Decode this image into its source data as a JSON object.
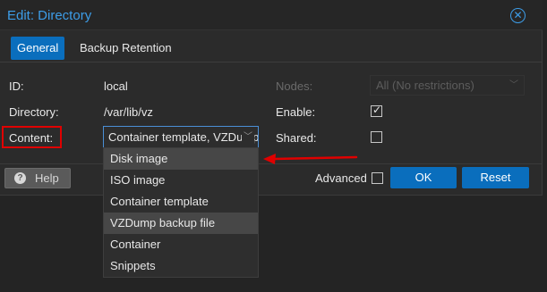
{
  "dialog": {
    "title": "Edit: Directory",
    "close_icon": "close-circle-icon"
  },
  "tabs": [
    {
      "label": "General",
      "active": true
    },
    {
      "label": "Backup Retention",
      "active": false
    }
  ],
  "form": {
    "id_label": "ID:",
    "id_value": "local",
    "directory_label": "Directory:",
    "directory_value": "/var/lib/vz",
    "content_label": "Content:",
    "content_value": "Container template, VZDump backup file",
    "nodes_label": "Nodes:",
    "nodes_value": "All (No restrictions)",
    "enable_label": "Enable:",
    "enable_checked": true,
    "shared_label": "Shared:",
    "shared_checked": false
  },
  "content_dropdown": {
    "options": [
      {
        "label": "Disk image",
        "selected": true
      },
      {
        "label": "ISO image",
        "selected": false
      },
      {
        "label": "Container template",
        "selected": false
      },
      {
        "label": "VZDump backup file",
        "selected": true
      },
      {
        "label": "Container",
        "selected": false
      },
      {
        "label": "Snippets",
        "selected": false
      }
    ]
  },
  "footer": {
    "help_label": "Help",
    "advanced_label": "Advanced",
    "advanced_checked": false,
    "ok_label": "OK",
    "reset_label": "Reset"
  },
  "colors": {
    "accent": "#0a6ebd",
    "title_blue": "#3d9de8",
    "annotation_red": "#e00000"
  }
}
